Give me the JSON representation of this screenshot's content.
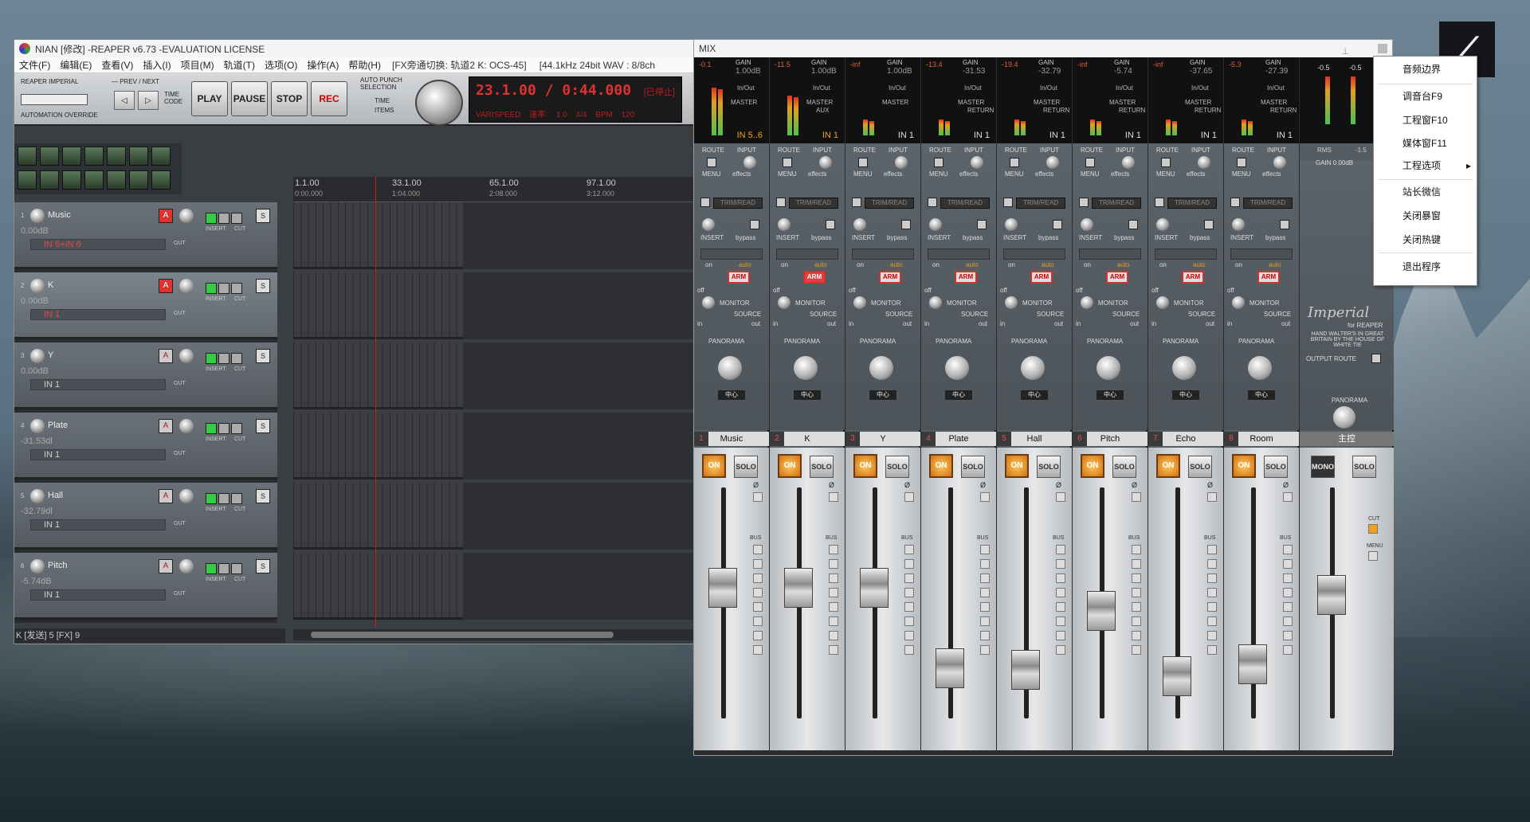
{
  "reaper": {
    "title": "NIAN [修改] -REAPER v6.73 -EVALUATION LICENSE",
    "menu": [
      "文件(F)",
      "编辑(E)",
      "查看(V)",
      "插入(I)",
      "项目(M)",
      "轨道(T)",
      "选项(O)",
      "操作(A)",
      "帮助(H)"
    ],
    "menu_status1": "[FX旁通切换: 轨道2 K: OCS-45]",
    "menu_status2": "[44.1kHz 24bit WAV : 8/8ch",
    "transport": {
      "brand": "REAPER IMPERIAL",
      "prev_next": "— PREV / NEXT",
      "time_code": "TIME CODE",
      "automation_override": "AUTOMATION OVERRIDE",
      "play": "PLAY",
      "pause": "PAUSE",
      "stop": "STOP",
      "rec": "REC",
      "auto_punch": "AUTO PUNCH SELECTION",
      "punch_time": "TIME",
      "punch_items": "ITEMS",
      "time": "23.1.00 / 0:44.000",
      "state": "[已停止]",
      "varispeed": "VARISPEED",
      "rate": "速率: 1.0",
      "sig": "4/4",
      "bpm": "BPM 120"
    },
    "ruler": [
      {
        "label": "1.1.00",
        "sub": "0:00.000"
      },
      {
        "label": "33.1.00",
        "sub": "1:04.000"
      },
      {
        "label": "65.1.00",
        "sub": "2:08.000"
      },
      {
        "label": "97.1.00",
        "sub": "3:12.000"
      }
    ],
    "tracks": [
      {
        "num": "1",
        "name": "Music",
        "vol": "0.00dB",
        "input": "IN 5+IN 6",
        "input_red": true,
        "armed": true,
        "selected": false
      },
      {
        "num": "2",
        "name": "K",
        "vol": "0.00dB",
        "input": "IN 1",
        "input_red": true,
        "armed": true,
        "selected": true
      },
      {
        "num": "3",
        "name": "Y",
        "vol": "0.00dB",
        "input": "IN 1",
        "input_red": false,
        "armed": false,
        "selected": false
      },
      {
        "num": "4",
        "name": "Plate",
        "vol": "-31.53dl",
        "input": "IN 1",
        "input_red": false,
        "armed": false,
        "selected": false
      },
      {
        "num": "5",
        "name": "Hall",
        "vol": "-32.79dl",
        "input": "IN 1",
        "input_red": false,
        "armed": false,
        "selected": false
      },
      {
        "num": "6",
        "name": "Pitch",
        "vol": "-5.74dB",
        "input": "IN 1",
        "input_red": false,
        "armed": false,
        "selected": false
      }
    ],
    "track_labels": {
      "fx": "FX",
      "in": "IN",
      "out": "OUT",
      "insert": "INSERT",
      "cut": "CUT",
      "s": "S",
      "a": "A"
    },
    "status": "K [发送] 5 [FX] 9"
  },
  "mix": {
    "title": "MIX",
    "pin_icon": "pin-icon",
    "labels": {
      "gain": "GAIN",
      "inout": "In/Out",
      "route": "ROUTE",
      "input": "INPUT",
      "menu": "MENU",
      "effects": "effects",
      "trim": "TRIM/READ",
      "insert": "INSERT",
      "bypass": "bypass",
      "on": "on",
      "off": "off",
      "auto": "auto",
      "monitor": "MONITOR",
      "source": "SOURCE",
      "in": "in",
      "out": "out",
      "panorama": "PANORAMA",
      "bus": "BUS",
      "on_btn": "ON",
      "solo": "SOLO",
      "phase": "Ø"
    },
    "strips": [
      {
        "num": "1",
        "name": "Music",
        "db": "-0.1",
        "gain": "1.00dB",
        "dest": "MASTER",
        "dest2": "",
        "input": "IN 5..6",
        "input_orange": true,
        "armed": false,
        "pan": "中心",
        "fader": 0.62
      },
      {
        "num": "2",
        "name": "K",
        "db": "-11.5",
        "gain": "1.00dB",
        "dest": "MASTER",
        "dest2": "AUX",
        "input": "IN 1",
        "input_orange": true,
        "armed": true,
        "pan": "中心",
        "fader": 0.62
      },
      {
        "num": "3",
        "name": "Y",
        "db": "-inf",
        "gain": "1.00dB",
        "dest": "MASTER",
        "dest2": "",
        "input": "IN 1",
        "input_orange": false,
        "armed": false,
        "pan": "中心",
        "fader": 0.62
      },
      {
        "num": "4",
        "name": "Plate",
        "db": "-13.4",
        "gain": "-31.53",
        "dest": "MASTER",
        "dest2": "RETURN",
        "input": "IN 1",
        "input_orange": false,
        "armed": false,
        "pan": "中心",
        "fader": 0.2
      },
      {
        "num": "5",
        "name": "Hall",
        "db": "-19.4",
        "gain": "-32.79",
        "dest": "MASTER",
        "dest2": "RETURN",
        "input": "IN 1",
        "input_orange": false,
        "armed": false,
        "pan": "中心",
        "fader": 0.19
      },
      {
        "num": "6",
        "name": "Pitch",
        "db": "-inf",
        "gain": "-5.74",
        "dest": "MASTER",
        "dest2": "RETURN",
        "input": "IN 1",
        "input_orange": false,
        "armed": false,
        "pan": "中心",
        "fader": 0.5
      },
      {
        "num": "7",
        "name": "Echo",
        "db": "-inf",
        "gain": "-37.65",
        "dest": "MASTER",
        "dest2": "RETURN",
        "input": "IN 1",
        "input_orange": false,
        "armed": false,
        "pan": "中心",
        "fader": 0.16
      },
      {
        "num": "8",
        "name": "Room",
        "db": "-5.3",
        "gain": "-27.39",
        "dest": "MASTER",
        "dest2": "RETURN",
        "input": "IN 1",
        "input_orange": false,
        "armed": false,
        "pan": "中心",
        "fader": 0.22
      }
    ],
    "master": {
      "name": "主控",
      "db1": "-0.5",
      "db2": "-0.5",
      "rms": "RMS",
      "rmsval": "-1.5",
      "gain": "GAIN 0.00dB",
      "brand": "Imperial",
      "brand_sub": "for REAPER",
      "credit": "HAND WALTER'S IN GREAT BRITAIN BY THE HOUSE OF WHITE TIE",
      "output_route": "OUTPUT ROUTE",
      "mono": "MONO",
      "solo": "SOLO",
      "cut": "CUT",
      "menu": "MENU",
      "pan": "中心"
    }
  },
  "context_menu": {
    "items": [
      "音频边界",
      "调音台F9",
      "工程窗F10",
      "媒体窗F11",
      "工程选项",
      "站长微信",
      "关闭暴窗",
      "关闭热键",
      "退出程序"
    ]
  }
}
